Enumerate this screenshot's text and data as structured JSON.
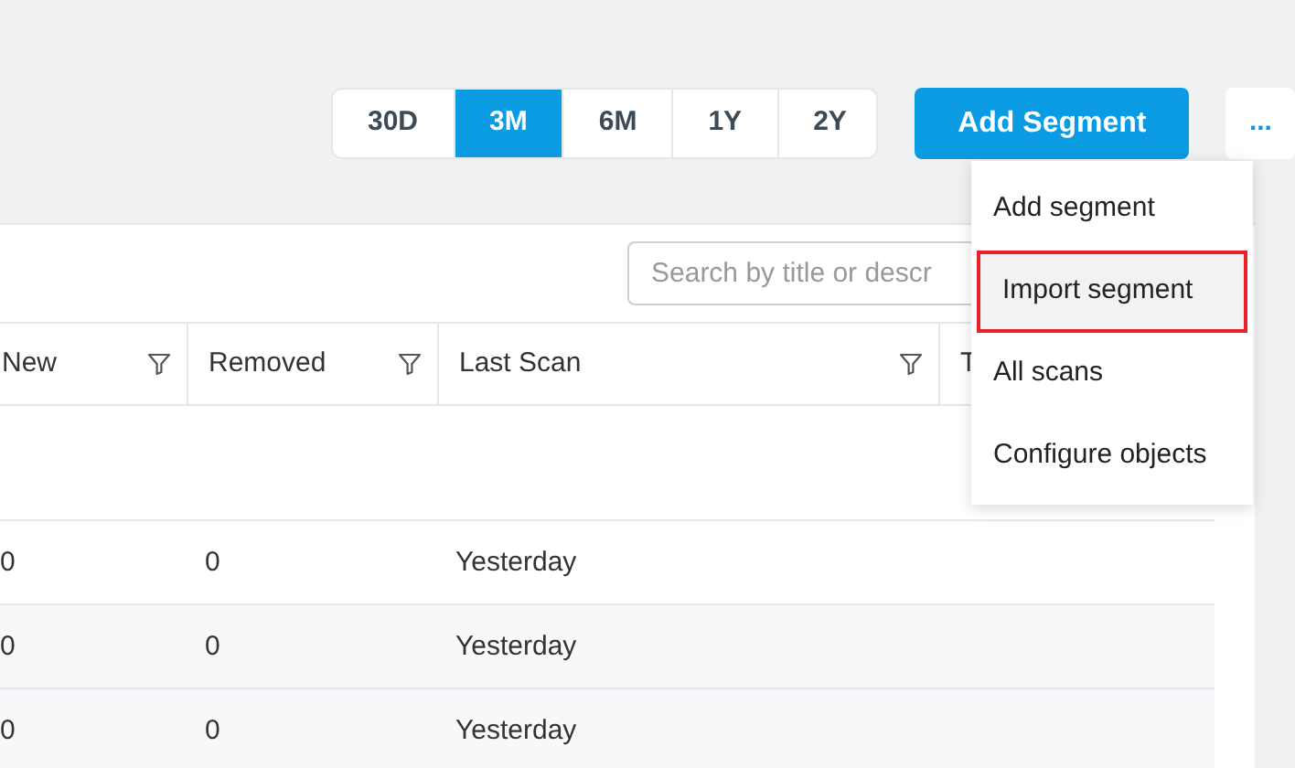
{
  "ranges": [
    {
      "label": "30D",
      "selected": false
    },
    {
      "label": "3M",
      "selected": true
    },
    {
      "label": "6M",
      "selected": false
    },
    {
      "label": "1Y",
      "selected": false
    },
    {
      "label": "2Y",
      "selected": false
    }
  ],
  "add_button": "Add Segment",
  "more_button": "...",
  "menu": [
    {
      "label": "Add segment",
      "highlighted": false
    },
    {
      "label": "Import segment",
      "highlighted": true
    },
    {
      "label": "All scans",
      "highlighted": false
    },
    {
      "label": "Configure objects",
      "highlighted": false
    }
  ],
  "search": {
    "placeholder": "Search by title or descr"
  },
  "table": {
    "columns": [
      {
        "label": "New",
        "filter": true
      },
      {
        "label": "Removed",
        "filter": true
      },
      {
        "label": "Last Scan",
        "filter": true
      },
      {
        "label": "T"
      }
    ],
    "rows": [
      [
        "0",
        "0",
        "Yesterday"
      ],
      [
        "0",
        "0",
        "Yesterday"
      ],
      [
        "0",
        "0",
        "Yesterday"
      ]
    ]
  }
}
